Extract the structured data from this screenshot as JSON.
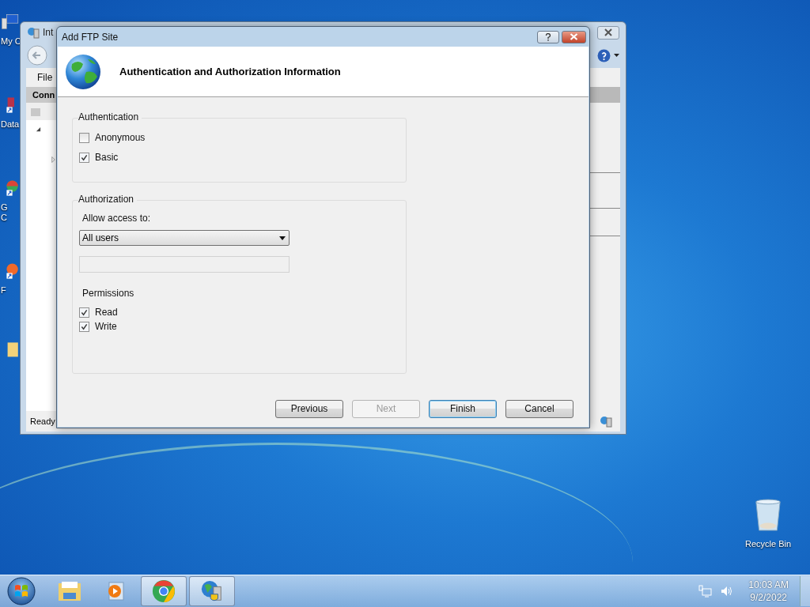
{
  "desktop": {
    "icons": [
      {
        "kind": "computer",
        "lines": [
          "My C"
        ]
      },
      {
        "kind": "shortcut-red",
        "lines": [
          "Data"
        ]
      },
      {
        "kind": "shortcut-chrome",
        "lines": [
          "G",
          "C"
        ]
      },
      {
        "kind": "shortcut-orange",
        "lines": [
          "F"
        ]
      },
      {
        "kind": "folder"
      }
    ],
    "recycle_bin": {
      "label": "Recycle Bin"
    }
  },
  "background_window": {
    "title": "Int",
    "menu": [
      "File"
    ],
    "panel_header": "Conn",
    "status": "Ready"
  },
  "dialog": {
    "title": "Add FTP Site",
    "heading": "Authentication and Authorization Information",
    "authentication": {
      "title": "Authentication",
      "options": [
        {
          "label": "Anonymous",
          "checked": false
        },
        {
          "label": "Basic",
          "checked": true
        }
      ]
    },
    "authorization": {
      "title": "Authorization",
      "access_label": "Allow access to:",
      "access_value": "All users",
      "permissions_title": "Permissions",
      "permissions": [
        {
          "label": "Read",
          "checked": true
        },
        {
          "label": "Write",
          "checked": true
        }
      ]
    },
    "buttons": [
      {
        "label": "Previous",
        "disabled": false,
        "default": false
      },
      {
        "label": "Next",
        "disabled": true,
        "default": false
      },
      {
        "label": "Finish",
        "disabled": false,
        "default": true
      },
      {
        "label": "Cancel",
        "disabled": false,
        "default": false
      }
    ]
  },
  "taskbar": {
    "apps": [
      {
        "kind": "folder",
        "active": false
      },
      {
        "kind": "media",
        "active": false
      },
      {
        "kind": "chrome",
        "active": true
      },
      {
        "kind": "iis",
        "active": true
      }
    ],
    "time": "10:03 AM",
    "date": "9/2/2022"
  }
}
